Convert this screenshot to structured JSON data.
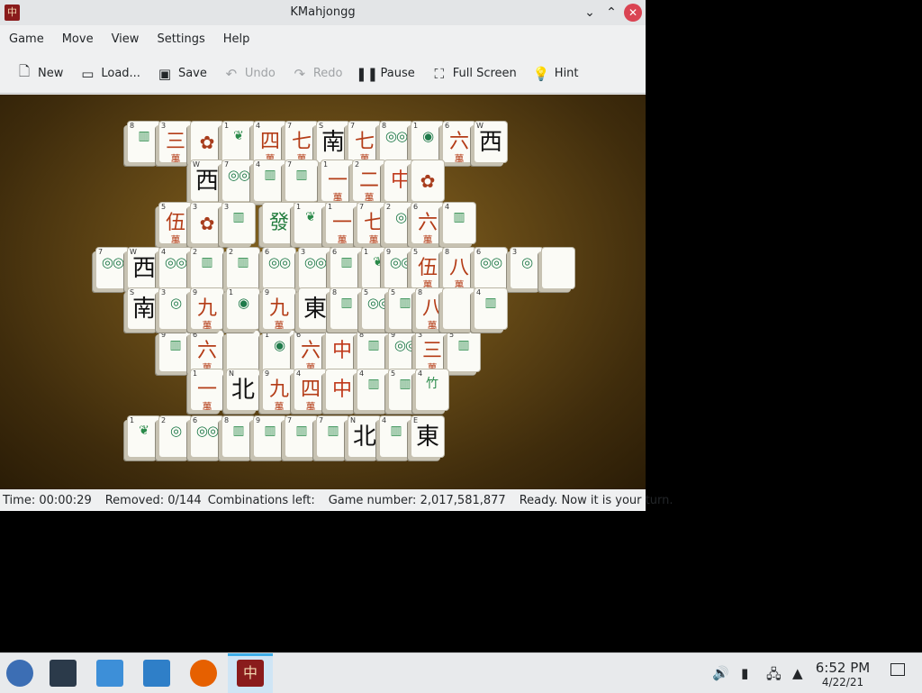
{
  "window": {
    "title": "KMahjongg",
    "app_icon": "中"
  },
  "menu": [
    "Game",
    "Move",
    "View",
    "Settings",
    "Help"
  ],
  "toolbar": [
    {
      "label": "New",
      "icon": "new-document-icon",
      "glyph": "🗋",
      "enabled": true
    },
    {
      "label": "Load...",
      "icon": "folder-icon",
      "glyph": "▭",
      "enabled": true
    },
    {
      "label": "Save",
      "icon": "save-icon",
      "glyph": "▣",
      "enabled": true
    },
    {
      "label": "Undo",
      "icon": "undo-icon",
      "glyph": "↶",
      "enabled": false
    },
    {
      "label": "Redo",
      "icon": "redo-icon",
      "glyph": "↷",
      "enabled": false
    },
    {
      "label": "Pause",
      "icon": "pause-icon",
      "glyph": "❚❚",
      "enabled": true
    },
    {
      "label": "Full Screen",
      "icon": "fullscreen-icon",
      "glyph": "⛶",
      "enabled": true
    },
    {
      "label": "Hint",
      "icon": "lightbulb-icon",
      "glyph": "💡",
      "enabled": true
    }
  ],
  "status": {
    "time": "Time: 00:00:29",
    "removed": "Removed: 0/144",
    "combinations": "Combinations left:",
    "game_number": "Game number: 2,017,581,877",
    "message": "Ready. Now it is your turn."
  },
  "taskbar": {
    "clock_time": "6:52 PM",
    "clock_date": "4/22/21",
    "accent": "#3daee9"
  },
  "tiles": [
    {
      "c": "8",
      "g": "▥",
      "k": "bam"
    },
    {
      "c": "3",
      "g": "三",
      "s": "萬",
      "k": "wan"
    },
    {
      "c": "",
      "g": "✿",
      "k": "flower"
    },
    {
      "c": "1",
      "g": "❦",
      "k": "bam"
    },
    {
      "c": "4",
      "g": "四",
      "s": "萬",
      "k": "wan"
    },
    {
      "c": "7",
      "g": "七",
      "s": "萬",
      "k": "wan"
    },
    {
      "c": "S",
      "g": "南",
      "k": "wind"
    },
    {
      "c": "7",
      "g": "七",
      "s": "萬",
      "k": "wan"
    },
    {
      "c": "8",
      "g": "◎◎",
      "k": "dot"
    },
    {
      "c": "1",
      "g": "◉",
      "k": "dot"
    },
    {
      "c": "6",
      "g": "六",
      "s": "萬",
      "k": "wan"
    },
    {
      "c": "W",
      "g": "西",
      "k": "wind"
    },
    {
      "c": "W",
      "g": "西",
      "k": "wind"
    },
    {
      "c": "7",
      "g": "◎◎",
      "k": "dot"
    },
    {
      "c": "4",
      "g": "▥",
      "k": "bam"
    },
    {
      "c": "7",
      "g": "▥",
      "k": "bam"
    },
    {
      "c": "1",
      "g": "一",
      "s": "萬",
      "k": "wan"
    },
    {
      "c": "2",
      "g": "二",
      "s": "萬",
      "k": "wan"
    },
    {
      "c": "",
      "g": "中",
      "k": "red"
    },
    {
      "c": "",
      "g": "✿",
      "k": "flower"
    },
    {
      "c": "5",
      "g": "伍",
      "s": "萬",
      "k": "wan"
    },
    {
      "c": "3",
      "g": "✿",
      "k": "flower"
    },
    {
      "c": "3",
      "g": "▥",
      "k": "bam"
    },
    {
      "c": "",
      "g": "發",
      "k": "green"
    },
    {
      "c": "1",
      "g": "❦",
      "k": "bam"
    },
    {
      "c": "1",
      "g": "一",
      "s": "萬",
      "k": "wan"
    },
    {
      "c": "7",
      "g": "七",
      "s": "萬",
      "k": "wan"
    },
    {
      "c": "2",
      "g": "◎",
      "k": "dot"
    },
    {
      "c": "6",
      "g": "六",
      "s": "萬",
      "k": "wan"
    },
    {
      "c": "4",
      "g": "▥",
      "k": "bam"
    },
    {
      "c": "7",
      "g": "◎◎",
      "k": "dot"
    },
    {
      "c": "W",
      "g": "西",
      "k": "wind"
    },
    {
      "c": "4",
      "g": "◎◎",
      "k": "dot"
    },
    {
      "c": "2",
      "g": "▥",
      "k": "bam"
    },
    {
      "c": "2",
      "g": "▥",
      "k": "bam"
    },
    {
      "c": "6",
      "g": "◎◎",
      "k": "dot"
    },
    {
      "c": "3",
      "g": "◎◎",
      "k": "dot"
    },
    {
      "c": "6",
      "g": "▥",
      "k": "bam"
    },
    {
      "c": "1",
      "g": "❦",
      "k": "bam"
    },
    {
      "c": "9",
      "g": "◎◎",
      "k": "dot"
    },
    {
      "c": "5",
      "g": "伍",
      "s": "萬",
      "k": "wan"
    },
    {
      "c": "8",
      "g": "八",
      "s": "萬",
      "k": "wan"
    },
    {
      "c": "6",
      "g": "◎◎",
      "k": "dot"
    },
    {
      "c": "3",
      "g": "◎",
      "k": "dot"
    },
    {
      "c": "",
      "g": "",
      "k": "blank"
    },
    {
      "c": "S",
      "g": "南",
      "k": "wind"
    },
    {
      "c": "3",
      "g": "◎",
      "k": "dot"
    },
    {
      "c": "9",
      "g": "九",
      "s": "萬",
      "k": "wan"
    },
    {
      "c": "1",
      "g": "◉",
      "k": "dot"
    },
    {
      "c": "9",
      "g": "九",
      "s": "萬",
      "k": "wan"
    },
    {
      "c": "",
      "g": "東",
      "k": "wind"
    },
    {
      "c": "8",
      "g": "▥",
      "k": "bam"
    },
    {
      "c": "5",
      "g": "◎◎",
      "k": "dot"
    },
    {
      "c": "5",
      "g": "▥",
      "k": "bam"
    },
    {
      "c": "8",
      "g": "八",
      "s": "萬",
      "k": "wan"
    },
    {
      "c": "",
      "g": "",
      "k": "blank"
    },
    {
      "c": "4",
      "g": "▥",
      "k": "bam"
    },
    {
      "c": "9",
      "g": "▥",
      "k": "bam"
    },
    {
      "c": "6",
      "g": "六",
      "s": "萬",
      "k": "wan"
    },
    {
      "c": "",
      "g": "",
      "k": "blank"
    },
    {
      "c": "1",
      "g": "◉",
      "k": "dot"
    },
    {
      "c": "6",
      "g": "六",
      "s": "萬",
      "k": "wan"
    },
    {
      "c": "",
      "g": "中",
      "k": "red"
    },
    {
      "c": "8",
      "g": "▥",
      "k": "bam"
    },
    {
      "c": "9",
      "g": "◎◎",
      "k": "dot"
    },
    {
      "c": "3",
      "g": "三",
      "s": "萬",
      "k": "wan"
    },
    {
      "c": "5",
      "g": "▥",
      "k": "bam"
    },
    {
      "c": "1",
      "g": "一",
      "s": "萬",
      "k": "wan"
    },
    {
      "c": "N",
      "g": "北",
      "k": "wind"
    },
    {
      "c": "9",
      "g": "九",
      "s": "萬",
      "k": "wan"
    },
    {
      "c": "4",
      "g": "四",
      "s": "萬",
      "k": "wan"
    },
    {
      "c": "",
      "g": "中",
      "k": "red"
    },
    {
      "c": "4",
      "g": "▥",
      "k": "bam"
    },
    {
      "c": "5",
      "g": "▥",
      "k": "bam"
    },
    {
      "c": "4",
      "g": "竹",
      "k": "bam"
    },
    {
      "c": "1",
      "g": "❦",
      "k": "bam"
    },
    {
      "c": "2",
      "g": "◎",
      "k": "dot"
    },
    {
      "c": "6",
      "g": "◎◎",
      "k": "dot"
    },
    {
      "c": "8",
      "g": "▥",
      "k": "bam"
    },
    {
      "c": "9",
      "g": "▥",
      "k": "bam"
    },
    {
      "c": "7",
      "g": "▥",
      "k": "bam"
    },
    {
      "c": "7",
      "g": "▥",
      "k": "bam"
    },
    {
      "c": "N",
      "g": "北",
      "k": "wind"
    },
    {
      "c": "4",
      "g": "▥",
      "k": "bam"
    },
    {
      "c": "E",
      "g": "東",
      "k": "wind"
    }
  ]
}
